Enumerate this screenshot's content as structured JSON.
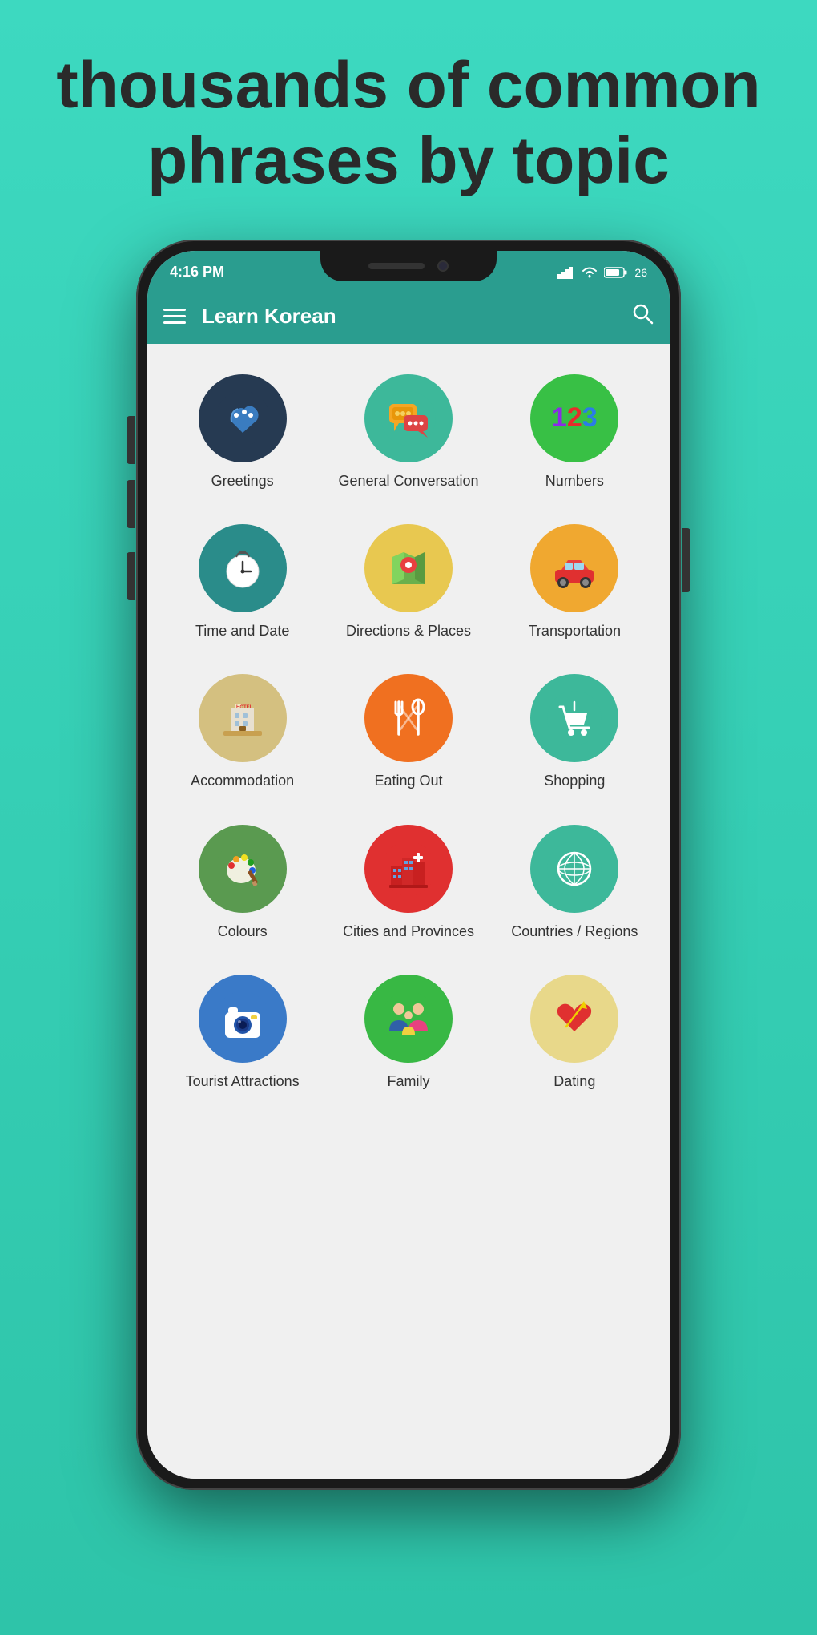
{
  "hero": {
    "line1": "thousands of common",
    "line2": "phrases by topic"
  },
  "status_bar": {
    "time": "4:16 PM",
    "battery": "26"
  },
  "app_bar": {
    "title": "Learn Korean"
  },
  "grid_items": [
    {
      "id": "greetings",
      "label": "Greetings",
      "color_class": "ic-greetings"
    },
    {
      "id": "conversation",
      "label": "General\nConversation",
      "color_class": "ic-conversation"
    },
    {
      "id": "numbers",
      "label": "Numbers",
      "color_class": "ic-numbers"
    },
    {
      "id": "time",
      "label": "Time and Date",
      "color_class": "ic-time"
    },
    {
      "id": "directions",
      "label": "Directions &\nPlaces",
      "color_class": "ic-directions"
    },
    {
      "id": "transport",
      "label": "Transportation",
      "color_class": "ic-transport"
    },
    {
      "id": "accommodation",
      "label": "Accommodation",
      "color_class": "ic-accommodation"
    },
    {
      "id": "eating",
      "label": "Eating Out",
      "color_class": "ic-eating"
    },
    {
      "id": "shopping",
      "label": "Shopping",
      "color_class": "ic-shopping"
    },
    {
      "id": "colours",
      "label": "Colours",
      "color_class": "ic-colours"
    },
    {
      "id": "cities",
      "label": "Cities and\nProvinces",
      "color_class": "ic-cities"
    },
    {
      "id": "countries",
      "label": "Countries /\nRegions",
      "color_class": "ic-countries"
    },
    {
      "id": "tourist",
      "label": "Tourist\nAttractions",
      "color_class": "ic-tourist"
    },
    {
      "id": "family",
      "label": "Family",
      "color_class": "ic-family"
    },
    {
      "id": "dating",
      "label": "Dating",
      "color_class": "ic-dating"
    }
  ]
}
